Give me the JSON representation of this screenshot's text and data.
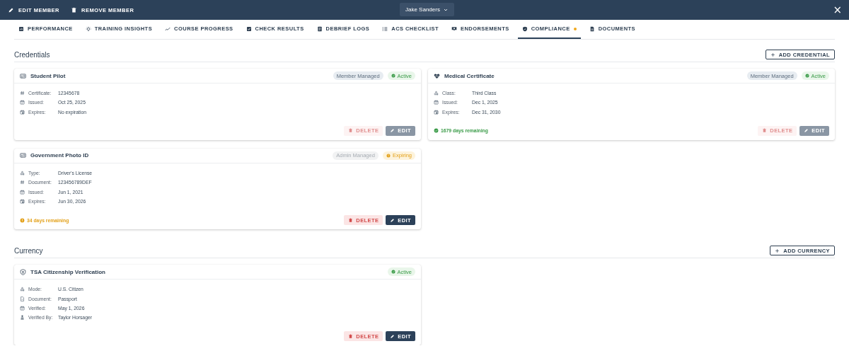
{
  "toolbar": {
    "actions": [
      {
        "kind": "edit",
        "label": "EDIT MEMBER"
      },
      {
        "kind": "remove",
        "label": "REMOVE MEMBER"
      }
    ],
    "member_selector": {
      "value": "Jake Sanders"
    },
    "close": "×"
  },
  "tabs": [
    {
      "label": "PERFORMANCE",
      "selected": false,
      "dot": false
    },
    {
      "label": "TRAINING INSIGHTS",
      "selected": false,
      "dot": false
    },
    {
      "label": "COURSE PROGRESS",
      "selected": false,
      "dot": false
    },
    {
      "label": "CHECK RESULTS",
      "selected": false,
      "dot": false
    },
    {
      "label": "DEBRIEF LOGS",
      "selected": false,
      "dot": false
    },
    {
      "label": "ACS CHECKLIST",
      "selected": false,
      "dot": false
    },
    {
      "label": "ENDORSEMENTS",
      "selected": false,
      "dot": false
    },
    {
      "label": "COMPLIANCE",
      "selected": true,
      "dot": true
    },
    {
      "label": "DOCUMENTS",
      "selected": false,
      "dot": false
    }
  ],
  "sections": [
    {
      "title": "Credentials",
      "add_button": "ADD CREDENTIAL",
      "cards": [
        {
          "kind": "id-card",
          "title": "Student Pilot",
          "managed": {
            "kind": "member",
            "text": "Member Managed"
          },
          "status": {
            "kind": "active",
            "text": "Active"
          },
          "fields": [
            {
              "kind": "number",
              "label": "Certificate:",
              "value": "12345678"
            },
            {
              "kind": "issued",
              "label": "Issued:",
              "value": "Oct 25, 2025"
            },
            {
              "kind": "expires",
              "label": "Expires:",
              "value": "No expiration"
            }
          ],
          "delete": {
            "label": "DELETE",
            "disabled": true
          },
          "edit": {
            "label": "EDIT",
            "disabled": true
          }
        },
        {
          "kind": "heart",
          "title": "Medical Certificate",
          "managed": {
            "kind": "member",
            "text": "Member Managed"
          },
          "status": {
            "kind": "active",
            "text": "Active"
          },
          "fields": [
            {
              "kind": "type",
              "label": "Class:",
              "value": "Third Class"
            },
            {
              "kind": "issued",
              "label": "Issued:",
              "value": "Dec 1, 2025"
            },
            {
              "kind": "expires",
              "label": "Expires:",
              "value": "Dec 31, 2030"
            }
          ],
          "remaining": {
            "kind": "active",
            "text": "1679 days remaining"
          },
          "delete": {
            "label": "DELETE",
            "disabled": true
          },
          "edit": {
            "label": "EDIT",
            "disabled": true
          }
        },
        {
          "kind": "id-card",
          "title": "Government Photo ID",
          "managed": {
            "kind": "admin",
            "text": "Admin Managed"
          },
          "status": {
            "kind": "expiring",
            "text": "Expiring"
          },
          "fields": [
            {
              "kind": "type",
              "label": "Type:",
              "value": "Driver's License"
            },
            {
              "kind": "number",
              "label": "Document:",
              "value": "123456789DEF"
            },
            {
              "kind": "issued",
              "label": "Issued:",
              "value": "Jun 1, 2021"
            },
            {
              "kind": "expires",
              "label": "Expires:",
              "value": "Jun 30, 2026"
            }
          ],
          "remaining": {
            "kind": "expiring",
            "text": "34 days remaining"
          },
          "delete": {
            "label": "DELETE",
            "disabled": false
          },
          "edit": {
            "label": "EDIT",
            "disabled": false
          }
        }
      ]
    },
    {
      "title": "Currency",
      "add_button": "ADD CURRENCY",
      "cards": [
        {
          "kind": "shield",
          "title": "TSA Citizenship Verification",
          "status": {
            "kind": "active",
            "text": "Active"
          },
          "fields": [
            {
              "kind": "type",
              "label": "Mode:",
              "value": "U.S. Citizen"
            },
            {
              "kind": "document",
              "label": "Document:",
              "value": "Passport"
            },
            {
              "kind": "issued",
              "label": "Verified:",
              "value": "May 1, 2026"
            },
            {
              "kind": "person",
              "label": "Verified By:",
              "value": "Taylor Horsager"
            }
          ],
          "delete": {
            "label": "DELETE",
            "disabled": false
          },
          "edit": {
            "label": "EDIT",
            "disabled": false
          }
        }
      ]
    }
  ]
}
